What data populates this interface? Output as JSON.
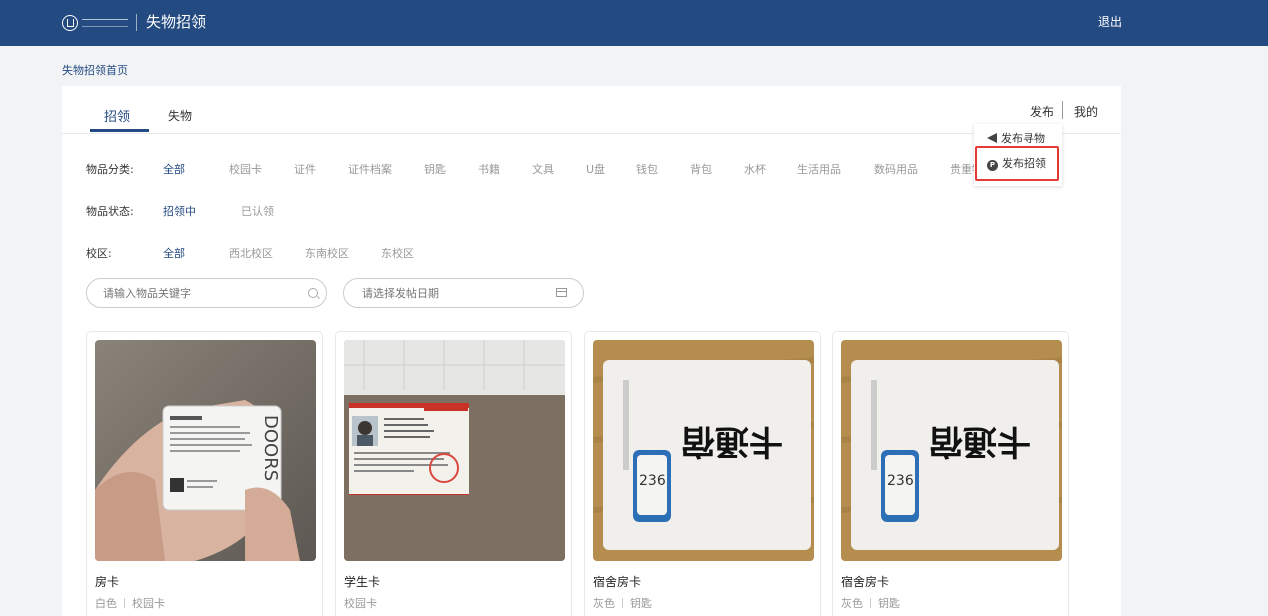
{
  "header": {
    "logo_text": "南京理工大学",
    "app_title": "失物招领",
    "logout_label": "退出"
  },
  "breadcrumb": "失物招领首页",
  "tabs": [
    {
      "label": "招领",
      "active": true
    },
    {
      "label": "失物",
      "active": false
    }
  ],
  "actions": {
    "publish_label": "发布",
    "mine_label": "我的"
  },
  "publish_menu": {
    "items": [
      {
        "label": "发布寻物",
        "icon": "send-icon"
      },
      {
        "label": "发布招领",
        "icon": "p-circle-icon",
        "highlighted": true
      }
    ]
  },
  "filters": {
    "category": {
      "label": "物品分类:",
      "options": [
        "全部",
        "校园卡",
        "证件",
        "证件档案",
        "钥匙",
        "书籍",
        "文具",
        "U盘",
        "钱包",
        "背包",
        "水杯",
        "生活用品",
        "数码用品",
        "贵重物品"
      ],
      "selected": "全部"
    },
    "status": {
      "label": "物品状态:",
      "options": [
        "招领中",
        "已认领"
      ],
      "selected": "招领中"
    },
    "campus": {
      "label": "校区:",
      "options": [
        "全部",
        "西北校区",
        "东南校区",
        "东校区"
      ],
      "selected": "全部"
    }
  },
  "search": {
    "placeholder": "请输入物品关键字"
  },
  "date_picker": {
    "placeholder": "请选择发帖日期"
  },
  "items": [
    {
      "name": "房卡",
      "color": "白色",
      "category": "校园卡",
      "photo": "hand-holding-room-card"
    },
    {
      "name": "学生卡",
      "color": "",
      "category": "校园卡",
      "photo": "student-id-card"
    },
    {
      "name": "宿舍房卡",
      "color": "灰色",
      "category": "钥匙",
      "photo": "dorm-card-on-wood"
    },
    {
      "name": "宿舍房卡",
      "color": "灰色",
      "category": "钥匙",
      "photo": "dorm-card-on-wood"
    }
  ],
  "colors": {
    "header_bg": "#244a82",
    "accent": "#244a82",
    "highlight": "#e53935",
    "page_bg": "#f2f3f5"
  }
}
